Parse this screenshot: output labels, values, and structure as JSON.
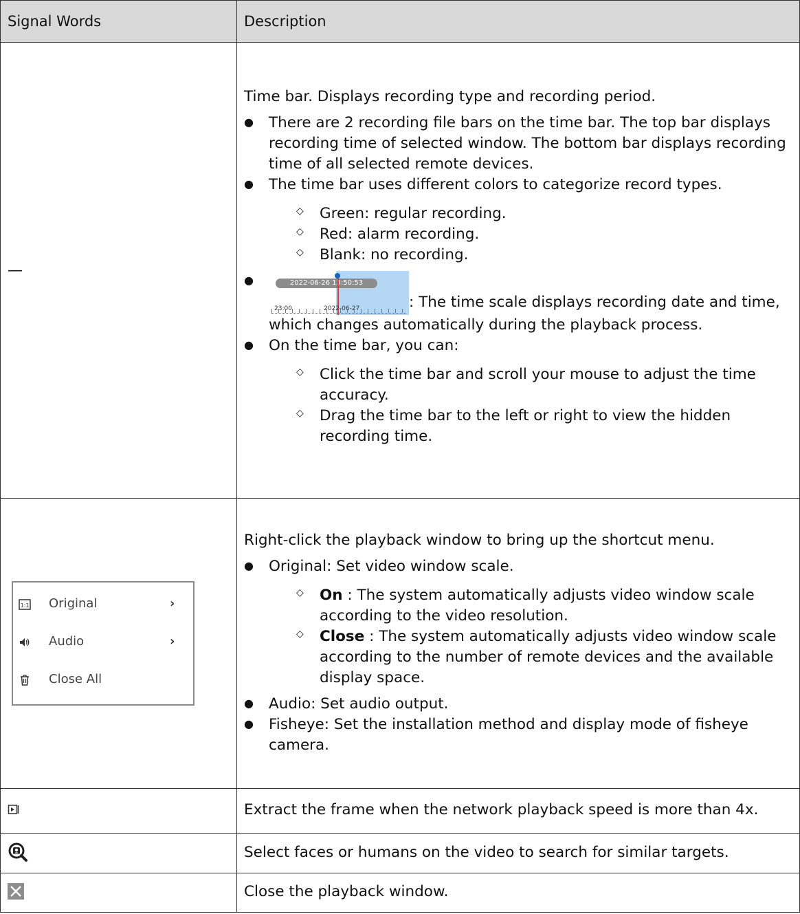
{
  "header": {
    "col1": "Signal Words",
    "col2": "Description"
  },
  "row1": {
    "signal": "—",
    "intro": "Time bar. Displays recording type and recording period.",
    "b1": "There are 2 recording file bars on the time bar. The top bar displays recording time of selected window. The bottom bar displays recording time of all selected remote devices.",
    "b2": "The time bar uses different colors to categorize record types.",
    "sub1": "Green: regular recording.",
    "sub2": "Red: alarm recording.",
    "sub3": "Blank: no recording.",
    "timescale": {
      "pill": "2022-06-26 13:50:53",
      "left_label": "23:00",
      "right_label": "2022-06-27"
    },
    "b3": ": The time scale displays recording date and time, which changes automatically during the playback process.",
    "b4": "On the time bar, you can:",
    "sub4": "Click the time bar and scroll your mouse to adjust the time accuracy.",
    "sub5": "Drag the time bar to the left or right to view the hidden recording time."
  },
  "row2": {
    "menu": [
      {
        "icon": "ratio-1-1-icon",
        "label": "Original"
      },
      {
        "icon": "speaker-icon",
        "label": "Audio"
      },
      {
        "icon": "trash-icon",
        "label": "Close All"
      }
    ],
    "intro": "Right-click the playback window to bring up the shortcut menu.",
    "b1": "Original: Set video window scale.",
    "on_label": "On",
    "on_text": " : The system automatically adjusts video window scale according to the video resolution.",
    "close_label": "Close",
    "close_text": " : The system automatically adjusts video window scale according to the number of remote devices and the available display space.",
    "b2": "Audio: Set audio output.",
    "b3": "Fisheye: Set the installation method and display mode of fisheye camera."
  },
  "row3": {
    "icon": "frame-extract-icon",
    "text": "Extract the frame when the network playback speed is more than 4x."
  },
  "row4": {
    "icon": "face-search-icon",
    "text": "Select faces or humans on the video to search for similar targets."
  },
  "row5": {
    "icon": "close-window-icon",
    "text": "Close the playback window."
  }
}
